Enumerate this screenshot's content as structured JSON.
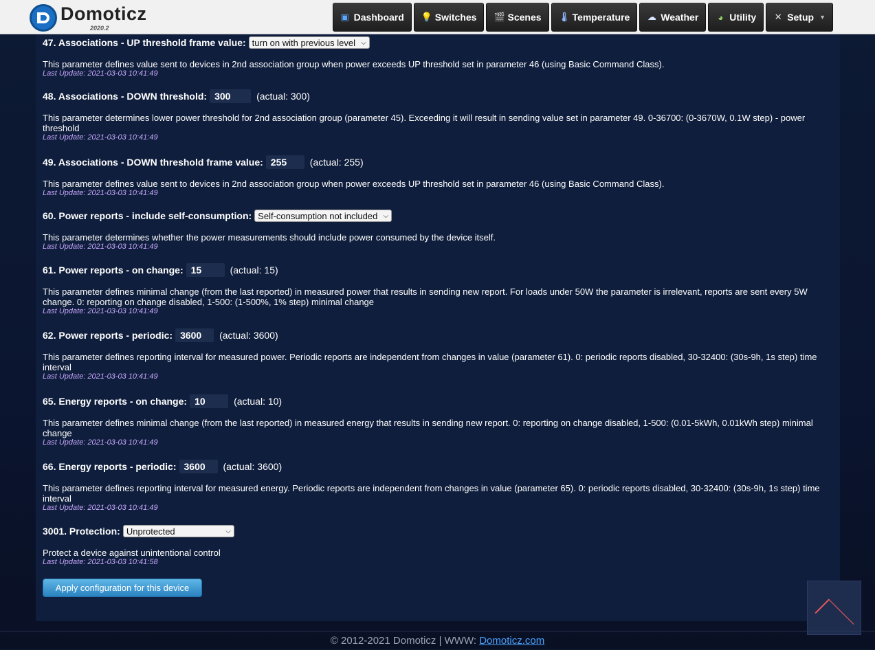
{
  "app": {
    "name": "Domoticz",
    "version": "2020.2"
  },
  "nav": [
    {
      "label": "Dashboard",
      "icon": "dashboard-icon"
    },
    {
      "label": "Switches",
      "icon": "lightbulb-icon"
    },
    {
      "label": "Scenes",
      "icon": "clapper-icon"
    },
    {
      "label": "Temperature",
      "icon": "thermometer-icon"
    },
    {
      "label": "Weather",
      "icon": "cloud-rain-icon"
    },
    {
      "label": "Utility",
      "icon": "utility-icon"
    },
    {
      "label": "Setup",
      "icon": "tools-icon"
    }
  ],
  "params": [
    {
      "title": "47. Associations - UP threshold frame value:",
      "type": "select",
      "value": "turn on with previous level",
      "actual": "",
      "desc": "This parameter defines value sent to devices in 2nd association group when power exceeds UP threshold set in parameter 46 (using Basic Command Class).",
      "date": "Last Update: 2021-03-03 10:41:49"
    },
    {
      "title": "48. Associations - DOWN threshold:",
      "type": "input",
      "value": "300",
      "actual": "(actual: 300)",
      "desc": "This parameter determines lower power threshold for 2nd association group (parameter 45). Exceeding it will result in sending value set in parameter 49. 0-36700: (0-3670W, 0.1W step) - power threshold",
      "date": "Last Update: 2021-03-03 10:41:49"
    },
    {
      "title": "49. Associations - DOWN threshold frame value:",
      "type": "input",
      "value": "255",
      "actual": "(actual: 255)",
      "desc": "This parameter defines value sent to devices in 2nd association group when power exceeds UP threshold set in parameter 46 (using Basic Command Class).",
      "date": "Last Update: 2021-03-03 10:41:49"
    },
    {
      "title": "60. Power reports - include self-consumption:",
      "type": "select",
      "value": "Self-consumption not included",
      "actual": "",
      "desc": "This parameter determines whether the power measurements should include power consumed by the device itself.",
      "date": "Last Update: 2021-03-03 10:41:49"
    },
    {
      "title": "61. Power reports - on change:",
      "type": "input",
      "value": "15",
      "actual": "(actual: 15)",
      "desc": "This parameter defines minimal change (from the last reported) in measured power that results in sending new report. For loads under 50W the parameter is irrelevant, reports are sent every 5W change. 0: reporting on change disabled, 1-500: (1-500%, 1% step) minimal change",
      "date": "Last Update: 2021-03-03 10:41:49"
    },
    {
      "title": "62. Power reports - periodic:",
      "type": "input",
      "value": "3600",
      "actual": "(actual: 3600)",
      "desc": "This parameter defines reporting interval for measured power. Periodic reports are independent from changes in value (parameter 61). 0: periodic reports disabled, 30-32400: (30s-9h, 1s step) time interval",
      "date": "Last Update: 2021-03-03 10:41:49"
    },
    {
      "title": "65. Energy reports - on change:",
      "type": "input",
      "value": "10",
      "actual": "(actual: 10)",
      "desc": "This parameter defines minimal change (from the last reported) in measured energy that results in sending new report. 0: reporting on change disabled, 1-500: (0.01-5kWh, 0.01kWh step) minimal change",
      "date": "Last Update: 2021-03-03 10:41:49"
    },
    {
      "title": "66. Energy reports - periodic:",
      "type": "input",
      "value": "3600",
      "actual": "(actual: 3600)",
      "desc": "This parameter defines reporting interval for measured energy. Periodic reports are independent from changes in value (parameter 65). 0: periodic reports disabled, 30-32400: (30s-9h, 1s step) time interval",
      "date": "Last Update: 2021-03-03 10:41:49"
    },
    {
      "title": "3001. Protection:",
      "type": "select",
      "value": "Unprotected",
      "actual": "",
      "desc": "Protect a device against unintentional control",
      "date": "Last Update: 2021-03-03 10:41:58"
    }
  ],
  "apply_label": "Apply configuration for this device",
  "footer": {
    "text": "© 2012-2021 Domoticz | WWW:",
    "link": "Domoticz.com"
  },
  "colors": {
    "accent": "#2a82c0",
    "date": "#c9a8ff",
    "panel": "#0f1e3c"
  }
}
